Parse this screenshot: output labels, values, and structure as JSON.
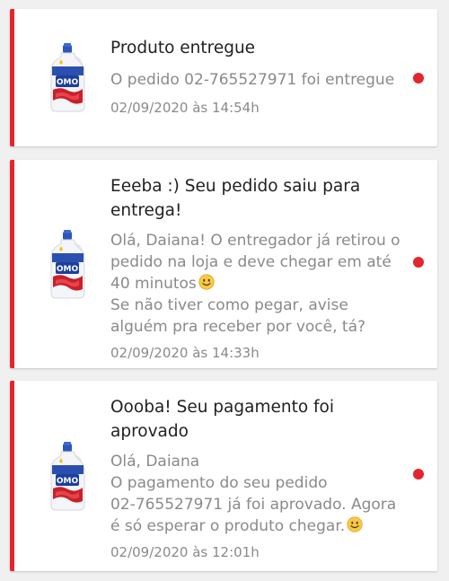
{
  "notifications": [
    {
      "title_lines": [
        "Produto entregue"
      ],
      "body_lines": [
        "O pedido 02-765527971 foi entregue"
      ],
      "date": "02/09/2020 às 14:54h",
      "product_icon": "omo-detergent-bottle-icon",
      "unread": true
    },
    {
      "title_lines": [
        "Eeeba :) Seu pedido saiu para",
        "entrega!"
      ],
      "body_lines": [
        "Olá, Daiana! O entregador já retirou o",
        "pedido na loja e deve chegar em até",
        "40 minutos",
        "Se não tiver como pegar, avise",
        "alguém pra receber por você, tá?"
      ],
      "date": "02/09/2020 às 14:33h",
      "product_icon": "omo-detergent-bottle-icon",
      "unread": true
    },
    {
      "title_lines": [
        "Oooba! Seu pagamento foi",
        "aprovado"
      ],
      "body_lines": [
        "Olá, Daiana",
        "O pagamento do seu pedido",
        "02-765527971 já foi aprovado. Agora",
        "é só esperar o produto chegar."
      ],
      "date": "02/09/2020 às 12:01h",
      "product_icon": "omo-detergent-bottle-icon",
      "unread": true
    }
  ],
  "colors": {
    "accent": "#e3262e",
    "title": "#212121",
    "body": "#8a8a8a",
    "background": "#f0f0f0"
  }
}
